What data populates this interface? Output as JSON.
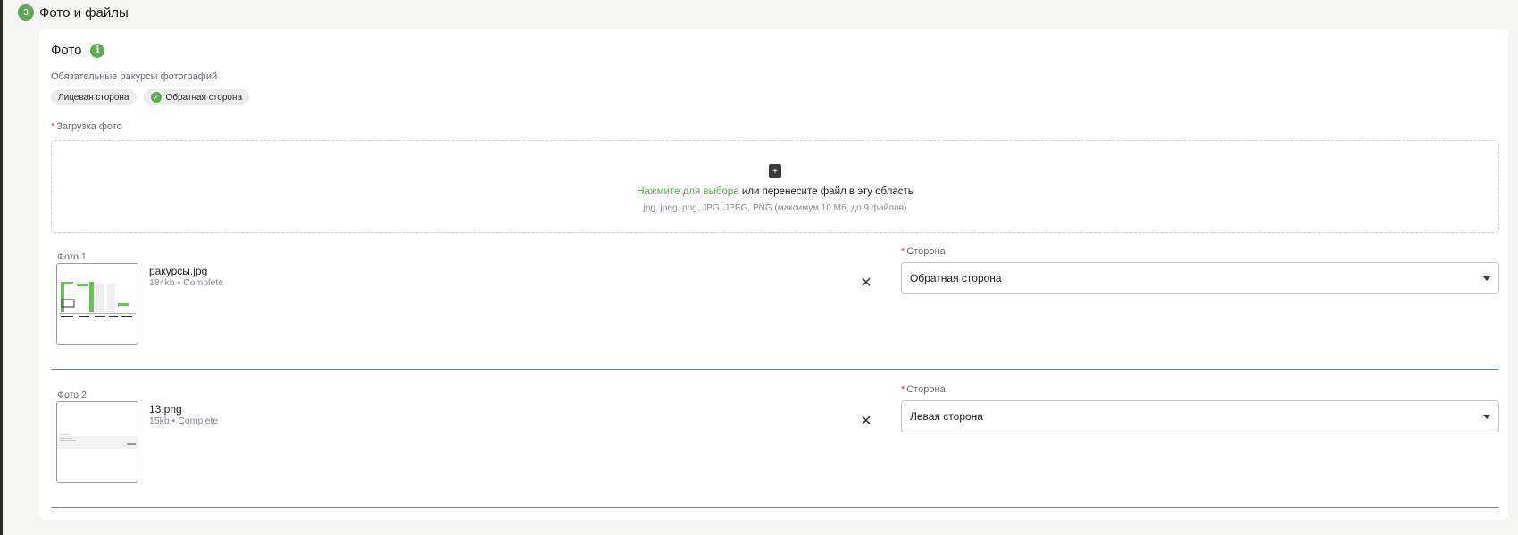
{
  "section": {
    "step": "3",
    "title": "Фото и файлы"
  },
  "card": {
    "title": "Фото",
    "info_icon": "i",
    "required_angles_label": "Обязательные ракурсы фотографий",
    "chips": [
      {
        "label": "Лицевая сторона",
        "checked": false
      },
      {
        "label": "Обратная сторона",
        "checked": true
      }
    ],
    "upload": {
      "label": "Загрузка фото",
      "link": "Нажмите для выбора",
      "text": "или перенесите файл в эту область",
      "hint": "jpg, jpeg, png, JPG, JPEG, PNG (максимум 10 Мб, до 9 файлов)"
    },
    "photos": [
      {
        "label": "Фото 1",
        "file_name": "ракурсы.jpg",
        "meta": "184kb  •  Complete",
        "side_label": "Сторона",
        "side_value": "Обратная сторона"
      },
      {
        "label": "Фото 2",
        "file_name": "13.png",
        "meta": "15kb  •  Complete",
        "side_label": "Сторона",
        "side_value": "Левая сторона"
      }
    ]
  },
  "colors": {
    "accent": "#5fa85a",
    "required": "#d9363e",
    "divider": "#7a82a0"
  },
  "icons": {
    "step": "step-number-icon",
    "info": "info-icon",
    "check": "check-icon",
    "upload": "file-upload-icon",
    "remove": "close-icon",
    "dropdown": "chevron-down-icon"
  }
}
